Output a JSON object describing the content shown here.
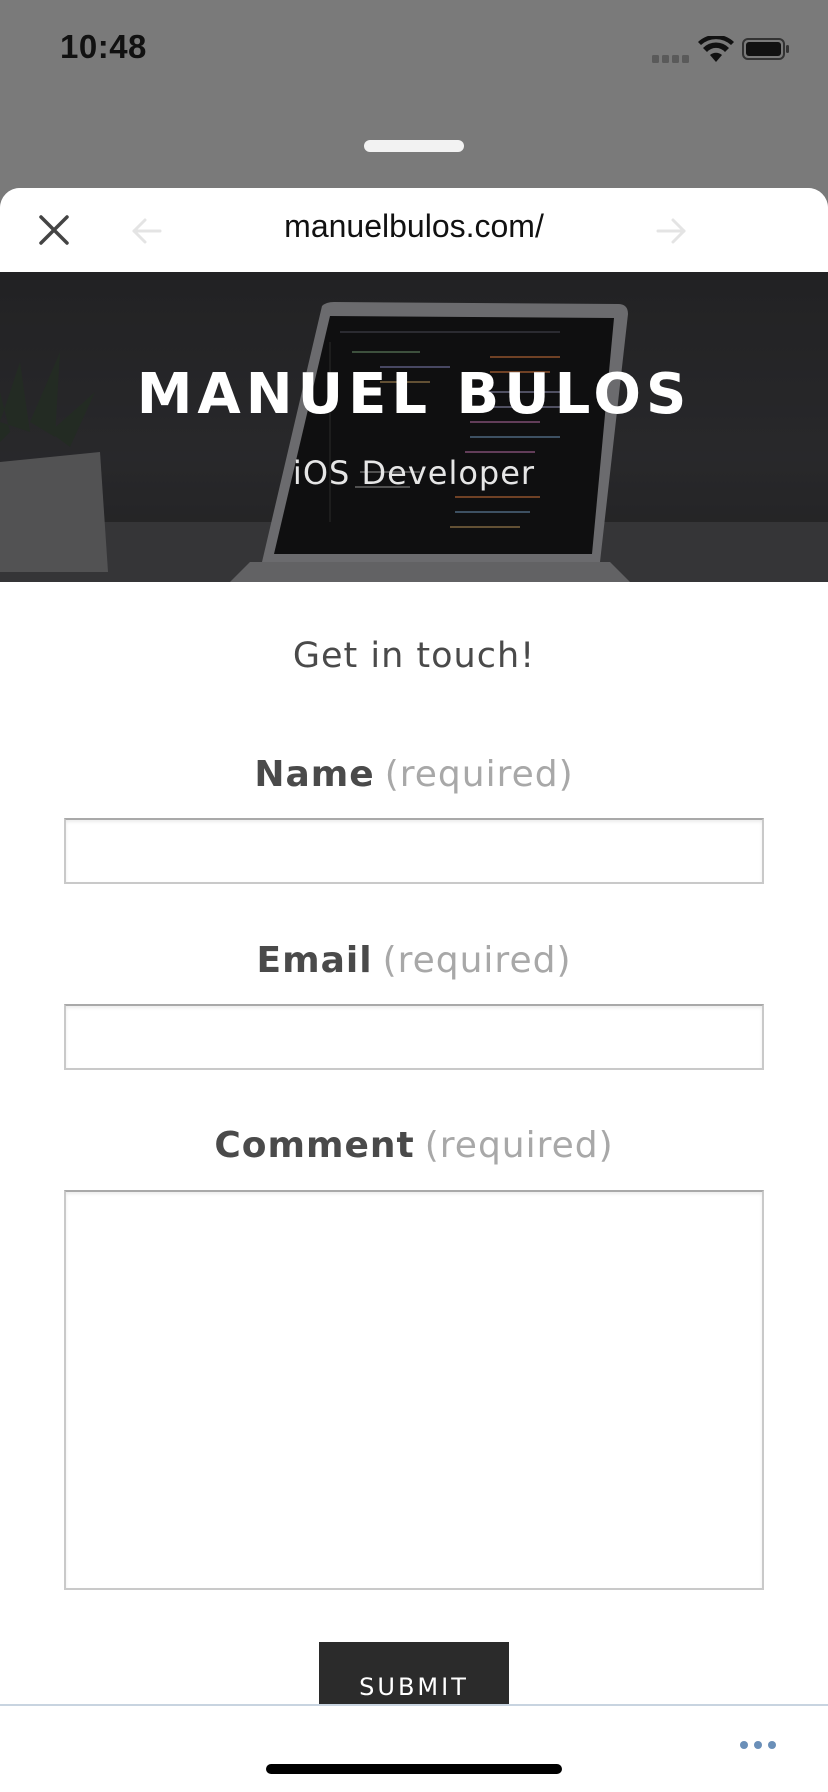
{
  "status_bar": {
    "time": "10:48",
    "icons": [
      "cellular-signal-icon",
      "wifi-icon",
      "battery-icon"
    ]
  },
  "browser": {
    "url": "manuelbulos.com/",
    "icons": [
      "close-icon",
      "back-arrow-icon",
      "forward-arrow-icon",
      "more-icon"
    ]
  },
  "hero": {
    "title": "MANUEL BULOS",
    "subtitle": "iOS Developer"
  },
  "form": {
    "heading": "Get in touch!",
    "required_text": "(required)",
    "name_label": "Name",
    "email_label": "Email",
    "comment_label": "Comment",
    "name_value": "",
    "email_value": "",
    "comment_value": "",
    "submit_label": "SUBMIT"
  },
  "colors": {
    "dim_background": "#7a7a7a",
    "hero_background": "#3b3b3e",
    "submit_background": "#2b2b2b",
    "label_text": "#4a4a4a",
    "required_text": "#a8a8a8",
    "more_dots": "#6a8fb8"
  }
}
